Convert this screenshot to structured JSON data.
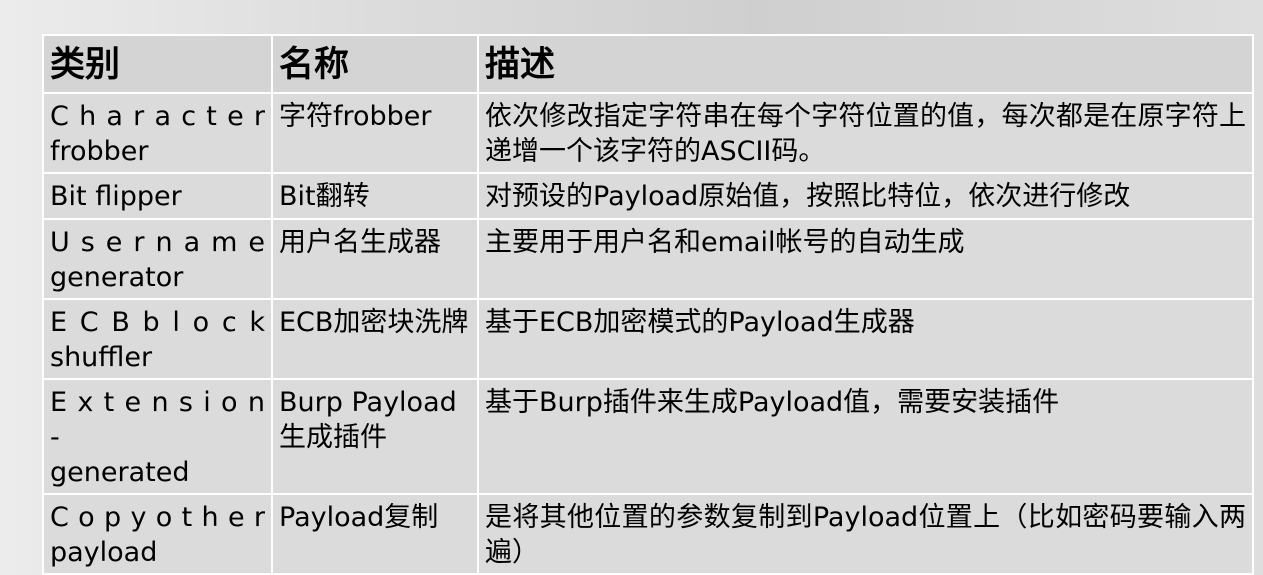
{
  "table": {
    "headers": [
      "类别",
      "名称",
      "描述"
    ],
    "rows": [
      {
        "category_line1": "C h a r a c t e r",
        "category_line2": "frobber",
        "name": "字符frobber",
        "description": "依次修改指定字符串在每个字符位置的值，每次都是在原字符上递增一个该字符的ASCII码。"
      },
      {
        "category_line1": "Bit flipper",
        "category_line2": "",
        "name": "Bit翻转",
        "description": "对预设的Payload原始值，按照比特位，依次进行修改"
      },
      {
        "category_line1": "U s e r n a m e",
        "category_line2": "generator",
        "name": "用户名生成器",
        "description": "主要用于用户名和email帐号的自动生成"
      },
      {
        "category_line1": "E C B   b l o c k",
        "category_line2": "shuffler",
        "name": "ECB加密块洗牌",
        "description": "基于ECB加密模式的Payload生成器"
      },
      {
        "category_line1": "E x t e n s i o n -",
        "category_line2": "generated",
        "name": "Burp Payload生成插件",
        "description": "基于Burp插件来生成Payload值，需要安装插件"
      },
      {
        "category_line1": "C o p y   o t h e r",
        "category_line2": "payload",
        "name": "Payload复制",
        "description": "是将其他位置的参数复制到Payload位置上（比如密码要输入两遍）"
      }
    ]
  }
}
